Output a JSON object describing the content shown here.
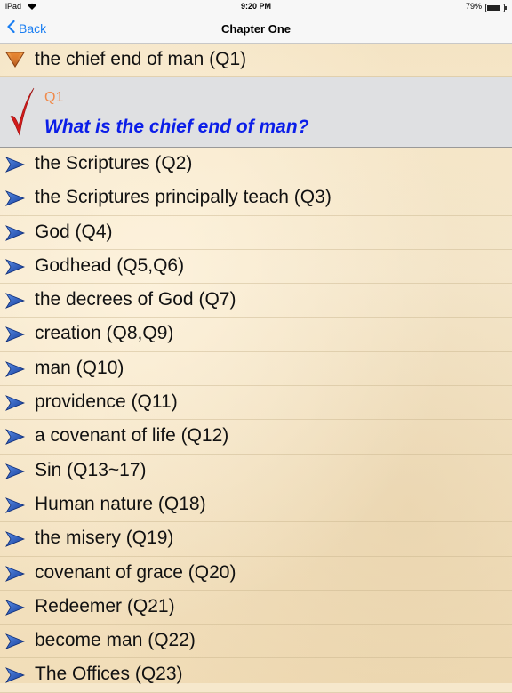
{
  "status": {
    "carrier": "iPad",
    "time": "9:20 PM",
    "battery_pct": "79%"
  },
  "nav": {
    "back_label": "Back",
    "title": "Chapter One"
  },
  "expanded": {
    "label": "the chief end of man (Q1)",
    "qnum": "Q1",
    "question": "What is the chief end of man?"
  },
  "items": [
    {
      "label": "the Scriptures (Q2)"
    },
    {
      "label": "the Scriptures principally teach (Q3)"
    },
    {
      "label": "God (Q4)"
    },
    {
      "label": "Godhead (Q5,Q6)"
    },
    {
      "label": "the decrees of God (Q7)"
    },
    {
      "label": "creation (Q8,Q9)"
    },
    {
      "label": "man (Q10)"
    },
    {
      "label": "providence (Q11)"
    },
    {
      "label": "a covenant of life (Q12)"
    },
    {
      "label": "Sin (Q13~17)"
    },
    {
      "label": "Human nature (Q18)"
    },
    {
      "label": "the misery (Q19)"
    },
    {
      "label": "covenant of grace (Q20)"
    },
    {
      "label": "Redeemer (Q21)"
    },
    {
      "label": "become man (Q22)"
    },
    {
      "label": "The Offices (Q23)"
    }
  ],
  "colors": {
    "accent": "#1a7ef2",
    "question": "#0b1ee8",
    "qnum": "#f08a4b",
    "arrow": "#1f4fc4",
    "check": "#d11a1a"
  }
}
